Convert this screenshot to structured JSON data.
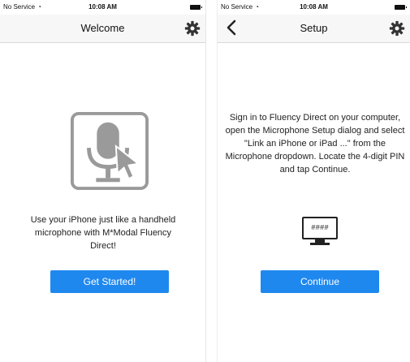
{
  "status": {
    "carrier": "No Service",
    "time": "10:08 AM"
  },
  "welcome": {
    "title": "Welcome",
    "message": "Use your iPhone just like a handheld microphone with M*Modal Fluency Direct!",
    "button_label": "Get Started!"
  },
  "setup": {
    "title": "Setup",
    "instructions": "Sign in to Fluency Direct  on your computer, open the Microphone Setup dialog and select \"Link an iPhone or iPad ...\" from the Microphone dropdown. Locate the 4-digit PIN and tap Continue.",
    "pin_placeholder": "####",
    "button_label": "Continue"
  },
  "colors": {
    "accent": "#1f88ef",
    "icon_gray": "#9a9a9a"
  },
  "icons": [
    "wifi-icon",
    "battery-icon",
    "gear-icon",
    "back-chevron-icon",
    "microphone-cursor-icon",
    "monitor-icon"
  ]
}
